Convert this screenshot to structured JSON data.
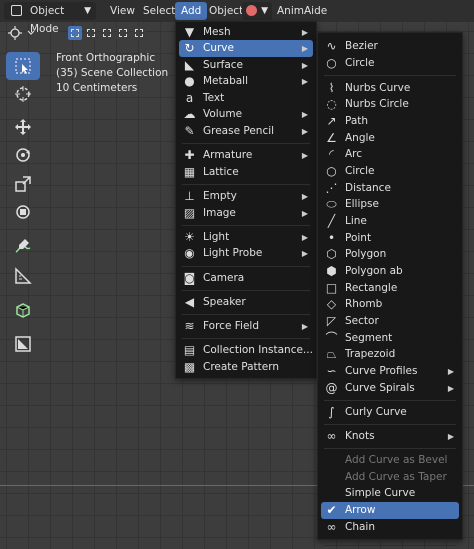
{
  "header": {
    "mode": "Object Mode",
    "menus": [
      "View",
      "Select",
      "Add",
      "Object"
    ],
    "addon": "AnimAide"
  },
  "overlay": {
    "view_name": "Front Orthographic",
    "collection": "(35) Scene Collection",
    "scale": "10 Centimeters"
  },
  "toolbar": {
    "tools": [
      "select-box-icon",
      "cursor-icon",
      "move-icon",
      "rotate-icon",
      "scale-icon",
      "transform-icon",
      "annotate-icon",
      "measure-icon",
      "add-cube-icon",
      "camera-frame-icon"
    ]
  },
  "add_menu": {
    "items": [
      {
        "label": "Mesh",
        "icon": "mesh-icon",
        "submenu": true
      },
      {
        "label": "Curve",
        "icon": "curve-icon",
        "submenu": true,
        "highlight": true
      },
      {
        "label": "Surface",
        "icon": "surface-icon",
        "submenu": true
      },
      {
        "label": "Metaball",
        "icon": "metaball-icon",
        "submenu": true
      },
      {
        "label": "Text",
        "icon": "text-icon",
        "submenu": false
      },
      {
        "label": "Volume",
        "icon": "volume-icon",
        "submenu": true
      },
      {
        "label": "Grease Pencil",
        "icon": "grease-pencil-icon",
        "submenu": true
      },
      {
        "label": "Armature",
        "icon": "armature-icon",
        "submenu": true
      },
      {
        "label": "Lattice",
        "icon": "lattice-icon",
        "submenu": false
      },
      {
        "label": "Empty",
        "icon": "empty-icon",
        "submenu": true
      },
      {
        "label": "Image",
        "icon": "image-icon",
        "submenu": true
      },
      {
        "label": "Light",
        "icon": "light-icon",
        "submenu": true
      },
      {
        "label": "Light Probe",
        "icon": "light-probe-icon",
        "submenu": true
      },
      {
        "label": "Camera",
        "icon": "camera-icon",
        "submenu": false
      },
      {
        "label": "Speaker",
        "icon": "speaker-icon",
        "submenu": false
      },
      {
        "label": "Force Field",
        "icon": "force-field-icon",
        "submenu": true
      },
      {
        "label": "Collection Instance...",
        "icon": "collection-instance-icon",
        "submenu": false
      },
      {
        "label": "Create Pattern",
        "icon": "create-pattern-icon",
        "submenu": false
      }
    ]
  },
  "curve_menu": {
    "items": [
      {
        "label": "Bezier",
        "icon": "bezier-icon"
      },
      {
        "label": "Circle",
        "icon": "circle-curve-icon"
      },
      {
        "label": "Nurbs Curve",
        "icon": "nurbs-curve-icon"
      },
      {
        "label": "Nurbs Circle",
        "icon": "nurbs-circle-icon"
      },
      {
        "label": "Path",
        "icon": "path-icon"
      },
      {
        "label": "Angle",
        "icon": "angle-icon"
      },
      {
        "label": "Arc",
        "icon": "arc-icon"
      },
      {
        "label": "Circle",
        "icon": "circle-icon"
      },
      {
        "label": "Distance",
        "icon": "distance-icon"
      },
      {
        "label": "Ellipse",
        "icon": "ellipse-icon"
      },
      {
        "label": "Line",
        "icon": "line-icon"
      },
      {
        "label": "Point",
        "icon": "point-icon"
      },
      {
        "label": "Polygon",
        "icon": "polygon-icon"
      },
      {
        "label": "Polygon ab",
        "icon": "polygon-ab-icon"
      },
      {
        "label": "Rectangle",
        "icon": "rectangle-icon"
      },
      {
        "label": "Rhomb",
        "icon": "rhomb-icon"
      },
      {
        "label": "Sector",
        "icon": "sector-icon"
      },
      {
        "label": "Segment",
        "icon": "segment-icon"
      },
      {
        "label": "Trapezoid",
        "icon": "trapezoid-icon"
      },
      {
        "label": "Curve Profiles",
        "icon": "curve-profiles-icon",
        "submenu": true
      },
      {
        "label": "Curve Spirals",
        "icon": "curve-spirals-icon",
        "submenu": true
      },
      {
        "label": "Curly Curve",
        "icon": "curly-curve-icon"
      },
      {
        "label": "Knots",
        "icon": "knots-icon",
        "submenu": true
      },
      {
        "label": "Add Curve as Bevel",
        "disabled": true
      },
      {
        "label": "Add Curve as Taper",
        "disabled": true
      },
      {
        "label": "Simple Curve"
      },
      {
        "label": "Arrow",
        "icon": "arrow-icon",
        "highlight": true
      },
      {
        "label": "Chain",
        "icon": "chain-icon"
      }
    ]
  },
  "colors": {
    "accent": "#4772b3",
    "menu_bg": "#181818",
    "viewport_bg": "#3d3d3d",
    "x_axis": "#b94453"
  }
}
